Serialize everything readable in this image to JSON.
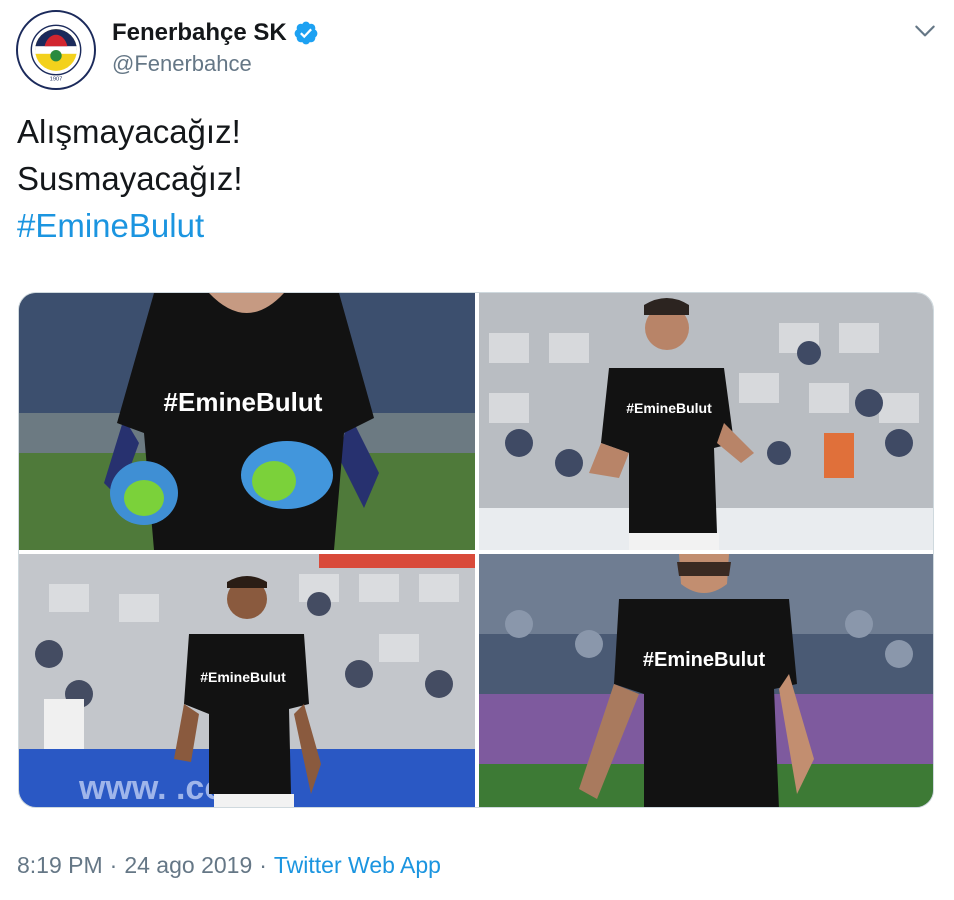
{
  "account": {
    "display_name": "Fenerbahçe SK",
    "handle": "@Fenerbahce",
    "verified_icon": "verified-badge-icon",
    "avatar_text": "FENERBAHÇE SPOR KULÜBÜ",
    "avatar_year": "1907"
  },
  "tweet": {
    "line1": "Alışmayacağız!",
    "line2": "Susmayacağız!",
    "hashtag": "#EmineBulut"
  },
  "media": {
    "photos": [
      {
        "shirt_text": "#EmineBulut"
      },
      {
        "shirt_text": "#EmineBulut"
      },
      {
        "shirt_text": "#EmineBulut"
      },
      {
        "shirt_text": "#EmineBulut"
      }
    ],
    "banner_text": "www.          .com"
  },
  "meta": {
    "time": "8:19 PM",
    "separator": "·",
    "date": "24 ago 2019",
    "source": "Twitter Web App"
  },
  "colors": {
    "link": "#1b95e0",
    "secondary_text": "#657786",
    "primary_text": "#14171a",
    "verified": "#1da1f2",
    "club_navy": "#1b2a5b",
    "club_yellow": "#f3d11c"
  }
}
